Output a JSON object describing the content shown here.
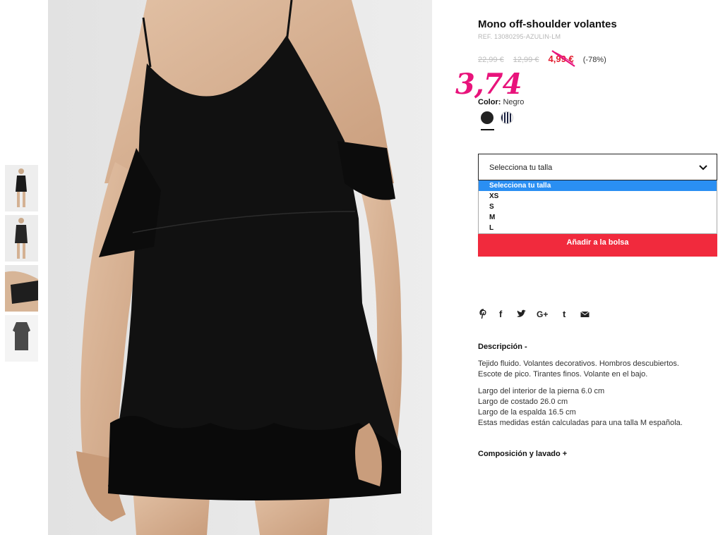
{
  "product": {
    "title": "Mono off-shoulder volantes",
    "ref": "REF. 13080295-AZULIN-LM",
    "prices": {
      "original": "22,99 €",
      "previous": "12,99 €",
      "sale": "4,99 €",
      "discount": "(-78%)",
      "handwritten": "3,74"
    },
    "color": {
      "label": "Color:",
      "value": "Negro",
      "swatches": [
        "black",
        "navy-stripe"
      ]
    },
    "size_select": {
      "value": "Selecciona tu talla",
      "options": [
        "Selecciona tu talla",
        "XS",
        "S",
        "M",
        "L"
      ]
    },
    "add_button": "Añadir a la bolsa",
    "social": [
      "pinterest-icon",
      "facebook-icon",
      "twitter-icon",
      "google-plus-icon",
      "tumblr-icon",
      "email-icon"
    ],
    "description": {
      "title": "Descripción -",
      "line1": "Tejido fluido. Volantes decorativos. Hombros descubiertos.",
      "line2": "Escote de pico. Tirantes finos. Volante en el bajo.",
      "line3": "Largo del interior de la pierna 6.0 cm",
      "line4": "Largo de costado 26.0 cm",
      "line5": "Largo de la espalda 16.5 cm",
      "line6": "Estas medidas están calculadas para una talla M española."
    },
    "composition_title": "Composición y lavado +"
  },
  "colors": {
    "accent": "#f12a3d",
    "sale": "#e21b2e",
    "handwritten": "#e8137b",
    "select_highlight": "#2a8ff3"
  }
}
